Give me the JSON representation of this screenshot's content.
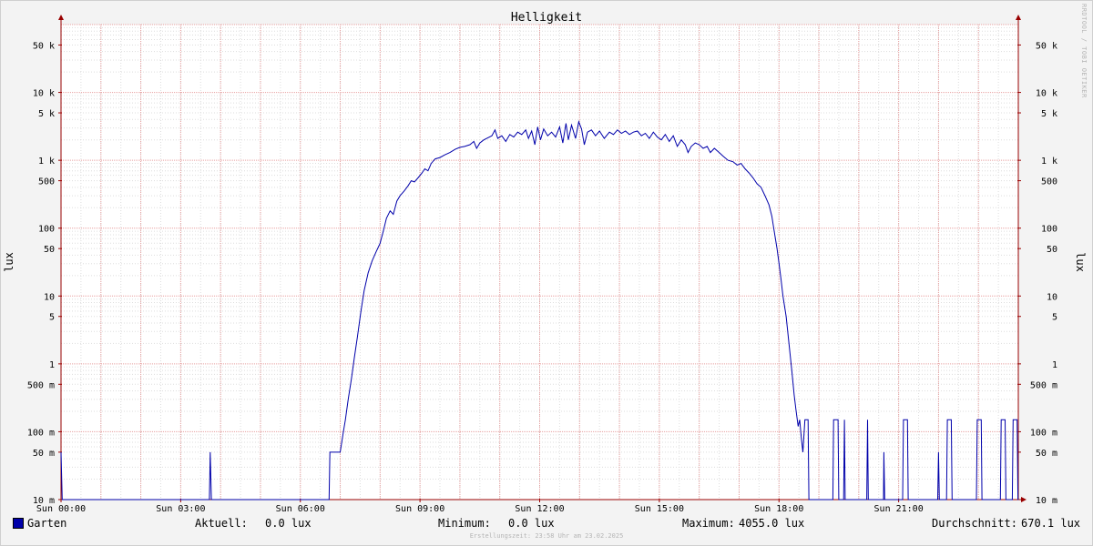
{
  "chart_data": {
    "type": "line",
    "title": "Helligkeit",
    "ylabel": "lux",
    "yscale": "log",
    "ylim": [
      0.01,
      100000
    ],
    "xlim": [
      0,
      24
    ],
    "x_ticks": [
      {
        "label": "Sun 00:00",
        "value": 0
      },
      {
        "label": "Sun 03:00",
        "value": 3
      },
      {
        "label": "Sun 06:00",
        "value": 6
      },
      {
        "label": "Sun 09:00",
        "value": 9
      },
      {
        "label": "Sun 12:00",
        "value": 12
      },
      {
        "label": "Sun 15:00",
        "value": 15
      },
      {
        "label": "Sun 18:00",
        "value": 18
      },
      {
        "label": "Sun 21:00",
        "value": 21
      }
    ],
    "y_ticks": [
      {
        "label": "50 k",
        "value": 50000
      },
      {
        "label": "10 k",
        "value": 10000
      },
      {
        "label": "5 k",
        "value": 5000
      },
      {
        "label": "1 k",
        "value": 1000
      },
      {
        "label": "500",
        "value": 500
      },
      {
        "label": "100",
        "value": 100
      },
      {
        "label": "50",
        "value": 50
      },
      {
        "label": "10",
        "value": 10
      },
      {
        "label": "5",
        "value": 5
      },
      {
        "label": "1",
        "value": 1
      },
      {
        "label": "500 m",
        "value": 0.5
      },
      {
        "label": "100 m",
        "value": 0.1
      },
      {
        "label": "50 m",
        "value": 0.05
      },
      {
        "label": "10 m",
        "value": 0.01
      }
    ],
    "grid": true,
    "series": [
      {
        "name": "Garten",
        "color": "#0000aa",
        "points": [
          [
            0.0,
            0.05
          ],
          [
            0.03,
            0.01
          ],
          [
            3.72,
            0.01
          ],
          [
            3.74,
            0.05
          ],
          [
            3.77,
            0.01
          ],
          [
            6.72,
            0.01
          ],
          [
            6.74,
            0.05
          ],
          [
            7.0,
            0.05
          ],
          [
            7.08,
            0.1
          ],
          [
            7.13,
            0.15
          ],
          [
            7.2,
            0.3
          ],
          [
            7.28,
            0.6
          ],
          [
            7.35,
            1.2
          ],
          [
            7.43,
            2.5
          ],
          [
            7.52,
            6
          ],
          [
            7.6,
            12
          ],
          [
            7.7,
            22
          ],
          [
            7.8,
            33
          ],
          [
            7.9,
            45
          ],
          [
            8.0,
            60
          ],
          [
            8.08,
            90
          ],
          [
            8.16,
            140
          ],
          [
            8.25,
            180
          ],
          [
            8.33,
            160
          ],
          [
            8.42,
            250
          ],
          [
            8.5,
            300
          ],
          [
            8.6,
            350
          ],
          [
            8.7,
            420
          ],
          [
            8.78,
            500
          ],
          [
            8.86,
            480
          ],
          [
            8.95,
            550
          ],
          [
            9.05,
            650
          ],
          [
            9.12,
            750
          ],
          [
            9.2,
            700
          ],
          [
            9.28,
            900
          ],
          [
            9.38,
            1050
          ],
          [
            9.5,
            1100
          ],
          [
            9.62,
            1200
          ],
          [
            9.75,
            1300
          ],
          [
            9.88,
            1450
          ],
          [
            10.0,
            1550
          ],
          [
            10.12,
            1600
          ],
          [
            10.25,
            1700
          ],
          [
            10.35,
            1900
          ],
          [
            10.42,
            1500
          ],
          [
            10.5,
            1800
          ],
          [
            10.6,
            2000
          ],
          [
            10.7,
            2150
          ],
          [
            10.8,
            2300
          ],
          [
            10.88,
            2800
          ],
          [
            10.95,
            2100
          ],
          [
            11.05,
            2300
          ],
          [
            11.15,
            1900
          ],
          [
            11.25,
            2400
          ],
          [
            11.35,
            2200
          ],
          [
            11.45,
            2600
          ],
          [
            11.55,
            2400
          ],
          [
            11.65,
            2800
          ],
          [
            11.72,
            2100
          ],
          [
            11.8,
            2700
          ],
          [
            11.88,
            1700
          ],
          [
            11.95,
            3100
          ],
          [
            12.02,
            2000
          ],
          [
            12.1,
            2900
          ],
          [
            12.2,
            2300
          ],
          [
            12.3,
            2600
          ],
          [
            12.4,
            2200
          ],
          [
            12.5,
            3100
          ],
          [
            12.58,
            1800
          ],
          [
            12.66,
            3500
          ],
          [
            12.72,
            2000
          ],
          [
            12.8,
            3300
          ],
          [
            12.9,
            2100
          ],
          [
            12.98,
            3700
          ],
          [
            13.05,
            2900
          ],
          [
            13.12,
            1700
          ],
          [
            13.2,
            2600
          ],
          [
            13.3,
            2800
          ],
          [
            13.4,
            2300
          ],
          [
            13.5,
            2700
          ],
          [
            13.62,
            2100
          ],
          [
            13.75,
            2600
          ],
          [
            13.85,
            2400
          ],
          [
            13.95,
            2800
          ],
          [
            14.05,
            2500
          ],
          [
            14.15,
            2700
          ],
          [
            14.25,
            2400
          ],
          [
            14.35,
            2600
          ],
          [
            14.45,
            2700
          ],
          [
            14.55,
            2300
          ],
          [
            14.65,
            2500
          ],
          [
            14.75,
            2100
          ],
          [
            14.85,
            2600
          ],
          [
            14.95,
            2200
          ],
          [
            15.05,
            2000
          ],
          [
            15.15,
            2400
          ],
          [
            15.25,
            1900
          ],
          [
            15.35,
            2300
          ],
          [
            15.45,
            1600
          ],
          [
            15.55,
            2000
          ],
          [
            15.65,
            1700
          ],
          [
            15.72,
            1300
          ],
          [
            15.8,
            1600
          ],
          [
            15.9,
            1800
          ],
          [
            16.0,
            1700
          ],
          [
            16.1,
            1500
          ],
          [
            16.2,
            1600
          ],
          [
            16.28,
            1300
          ],
          [
            16.38,
            1500
          ],
          [
            16.5,
            1300
          ],
          [
            16.6,
            1150
          ],
          [
            16.72,
            1000
          ],
          [
            16.85,
            950
          ],
          [
            16.95,
            850
          ],
          [
            17.05,
            900
          ],
          [
            17.15,
            750
          ],
          [
            17.25,
            650
          ],
          [
            17.35,
            550
          ],
          [
            17.45,
            450
          ],
          [
            17.55,
            400
          ],
          [
            17.65,
            300
          ],
          [
            17.75,
            220
          ],
          [
            17.82,
            150
          ],
          [
            17.88,
            90
          ],
          [
            17.95,
            50
          ],
          [
            18.0,
            30
          ],
          [
            18.05,
            18
          ],
          [
            18.1,
            10
          ],
          [
            18.18,
            5
          ],
          [
            18.25,
            2
          ],
          [
            18.32,
            0.8
          ],
          [
            18.38,
            0.35
          ],
          [
            18.43,
            0.2
          ],
          [
            18.48,
            0.12
          ],
          [
            18.52,
            0.15
          ],
          [
            18.56,
            0.08
          ],
          [
            18.6,
            0.05
          ],
          [
            18.65,
            0.15
          ],
          [
            18.7,
            0.15
          ],
          [
            18.73,
            0.15
          ],
          [
            18.75,
            0.01
          ],
          [
            19.35,
            0.01
          ],
          [
            19.37,
            0.15
          ],
          [
            19.48,
            0.15
          ],
          [
            19.5,
            0.01
          ],
          [
            19.62,
            0.01
          ],
          [
            19.64,
            0.15
          ],
          [
            19.66,
            0.01
          ],
          [
            20.2,
            0.01
          ],
          [
            20.22,
            0.15
          ],
          [
            20.24,
            0.01
          ],
          [
            20.62,
            0.01
          ],
          [
            20.63,
            0.05
          ],
          [
            20.65,
            0.01
          ],
          [
            21.1,
            0.01
          ],
          [
            21.12,
            0.15
          ],
          [
            21.22,
            0.15
          ],
          [
            21.24,
            0.01
          ],
          [
            21.98,
            0.01
          ],
          [
            22.0,
            0.05
          ],
          [
            22.02,
            0.01
          ],
          [
            22.2,
            0.01
          ],
          [
            22.22,
            0.15
          ],
          [
            22.32,
            0.15
          ],
          [
            22.34,
            0.01
          ],
          [
            22.95,
            0.01
          ],
          [
            22.97,
            0.15
          ],
          [
            23.07,
            0.15
          ],
          [
            23.09,
            0.01
          ],
          [
            23.55,
            0.01
          ],
          [
            23.57,
            0.15
          ],
          [
            23.67,
            0.15
          ],
          [
            23.69,
            0.01
          ],
          [
            23.85,
            0.01
          ],
          [
            23.87,
            0.15
          ],
          [
            23.97,
            0.15
          ],
          [
            23.99,
            0.01
          ],
          [
            24.0,
            0.01
          ]
        ]
      }
    ]
  },
  "legend": {
    "series_name": "Garten",
    "color": "#0000aa",
    "current_label": "Aktuell:",
    "current_value": "0.0 lux",
    "min_label": "Minimum:",
    "min_value": "0.0 lux",
    "max_label": "Maximum:",
    "max_value": "4055.0 lux",
    "avg_label": "Durchschnitt:",
    "avg_value": "670.1 lux"
  },
  "footer": {
    "created": "Erstellungszeit: 23:58 Uhr am 23.02.2025"
  },
  "watermark": "RRDTOOL / TOBI OETIKER",
  "colors": {
    "background": "#f3f3f3",
    "plot_background": "#ffffff",
    "major_grid": "#e8a0a0",
    "minor_grid": "#dddddd",
    "line": "#0000aa"
  }
}
